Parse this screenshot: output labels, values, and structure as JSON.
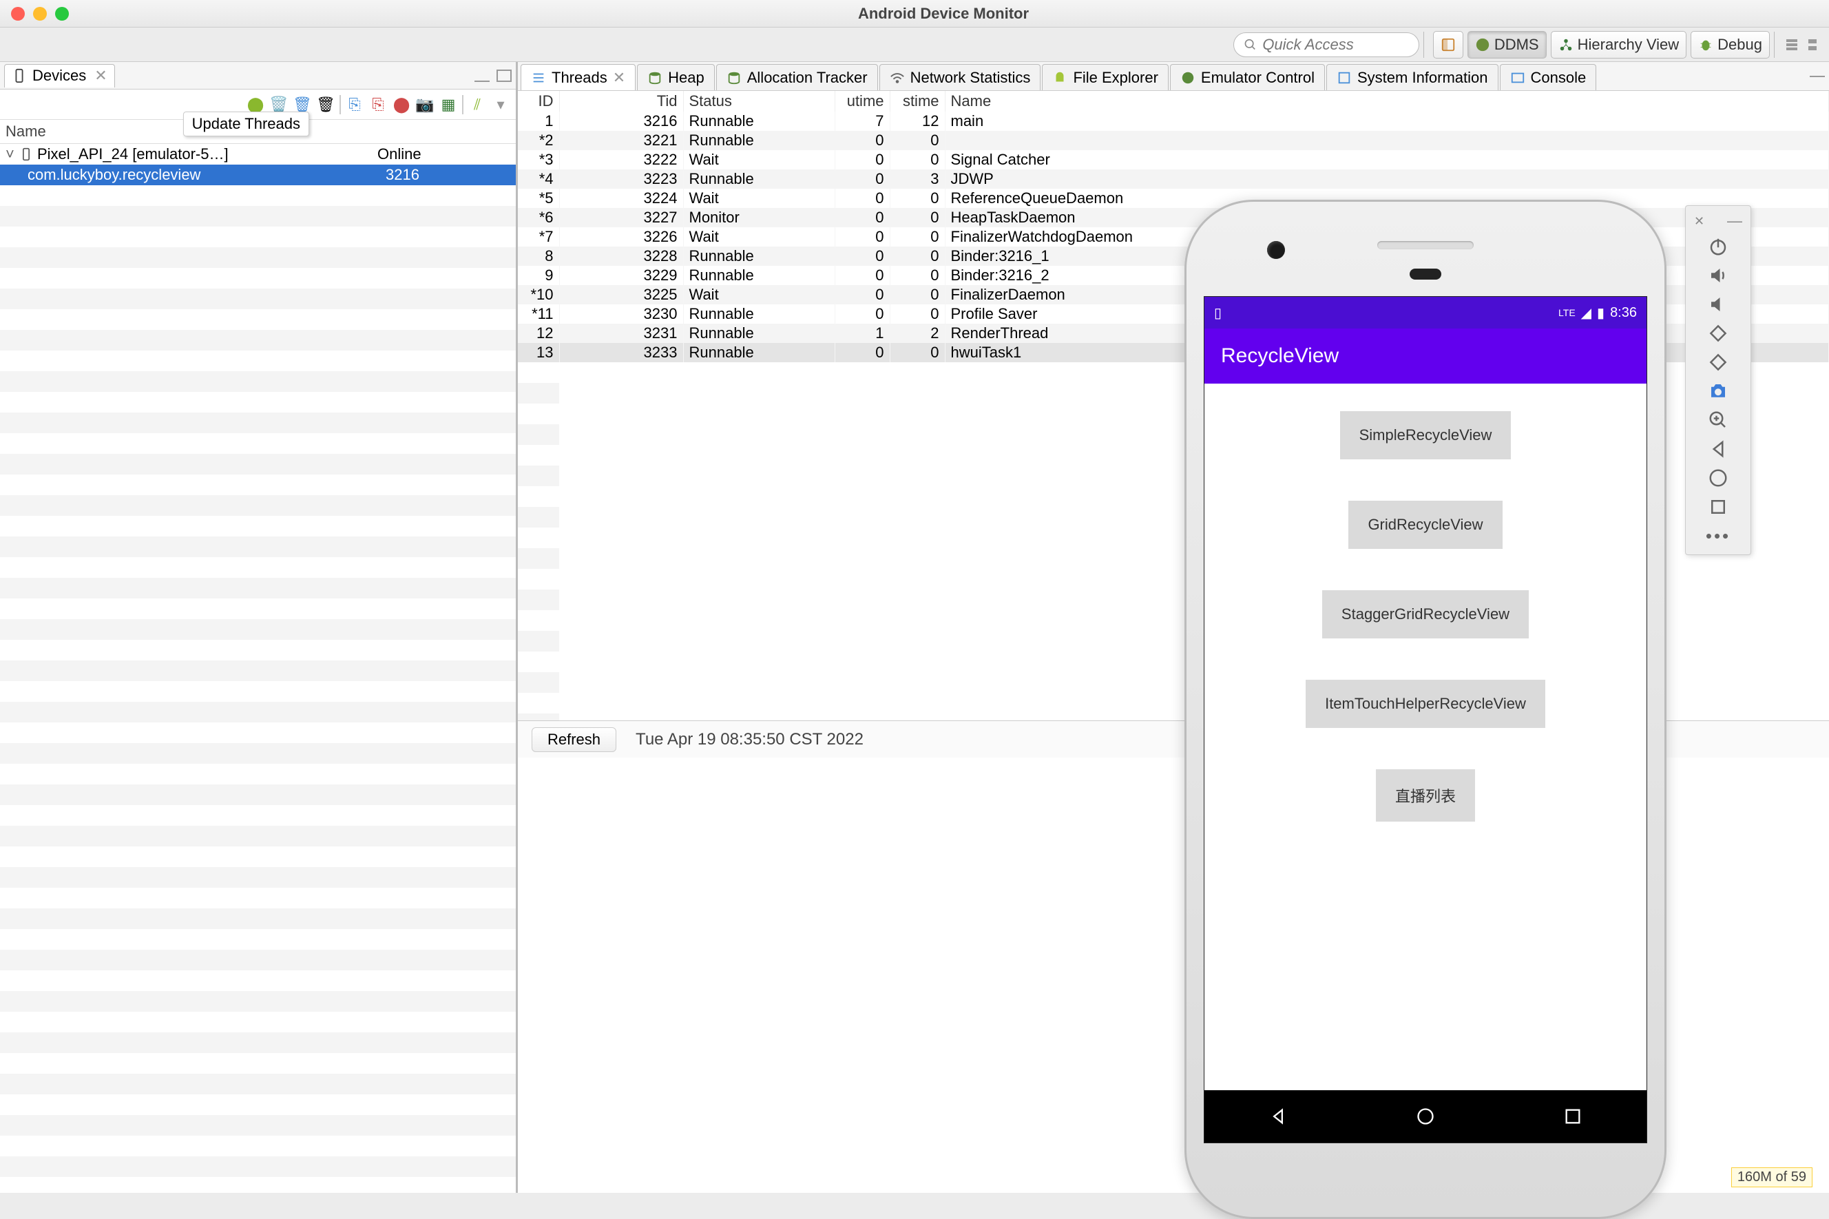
{
  "window": {
    "title": "Android Device Monitor"
  },
  "toolbar": {
    "quick_access_placeholder": "Quick Access",
    "perspectives": {
      "ddms": "DDMS",
      "hierarchy": "Hierarchy View",
      "debug": "Debug"
    }
  },
  "left_view": {
    "tab_label": "Devices",
    "tooltip": "Update Threads",
    "header": {
      "name": "Name",
      "status": ""
    },
    "device": {
      "label": "Pixel_API_24 [emulator-5…]",
      "status": "Online"
    },
    "process": {
      "label": "com.luckyboy.recycleview",
      "pid": "3216"
    }
  },
  "right_view": {
    "tabs": {
      "threads": "Threads",
      "heap": "Heap",
      "allocation": "Allocation Tracker",
      "network": "Network Statistics",
      "file": "File Explorer",
      "emulator": "Emulator Control",
      "sysinfo": "System Information",
      "console": "Console"
    },
    "active_tab": "threads"
  },
  "threads": {
    "columns": {
      "id": "ID",
      "tid": "Tid",
      "status": "Status",
      "utime": "utime",
      "stime": "stime",
      "name": "Name"
    },
    "rows": [
      {
        "id": "1",
        "tid": "3216",
        "status": "Runnable",
        "utime": "7",
        "stime": "12",
        "name": "main"
      },
      {
        "id": "*2",
        "tid": "3221",
        "status": "Runnable",
        "utime": "0",
        "stime": "0",
        "name": ""
      },
      {
        "id": "*3",
        "tid": "3222",
        "status": "Wait",
        "utime": "0",
        "stime": "0",
        "name": "Signal Catcher"
      },
      {
        "id": "*4",
        "tid": "3223",
        "status": "Runnable",
        "utime": "0",
        "stime": "3",
        "name": "JDWP"
      },
      {
        "id": "*5",
        "tid": "3224",
        "status": "Wait",
        "utime": "0",
        "stime": "0",
        "name": "ReferenceQueueDaemon"
      },
      {
        "id": "*6",
        "tid": "3227",
        "status": "Monitor",
        "utime": "0",
        "stime": "0",
        "name": "HeapTaskDaemon"
      },
      {
        "id": "*7",
        "tid": "3226",
        "status": "Wait",
        "utime": "0",
        "stime": "0",
        "name": "FinalizerWatchdogDaemon"
      },
      {
        "id": "8",
        "tid": "3228",
        "status": "Runnable",
        "utime": "0",
        "stime": "0",
        "name": "Binder:3216_1"
      },
      {
        "id": "9",
        "tid": "3229",
        "status": "Runnable",
        "utime": "0",
        "stime": "0",
        "name": "Binder:3216_2"
      },
      {
        "id": "*10",
        "tid": "3225",
        "status": "Wait",
        "utime": "0",
        "stime": "0",
        "name": "FinalizerDaemon"
      },
      {
        "id": "*11",
        "tid": "3230",
        "status": "Runnable",
        "utime": "0",
        "stime": "0",
        "name": "Profile Saver"
      },
      {
        "id": "12",
        "tid": "3231",
        "status": "Runnable",
        "utime": "1",
        "stime": "2",
        "name": "RenderThread"
      },
      {
        "id": "13",
        "tid": "3233",
        "status": "Runnable",
        "utime": "0",
        "stime": "0",
        "name": "hwuiTask1"
      }
    ],
    "refresh_label": "Refresh",
    "timestamp": "Tue Apr 19 08:35:50 CST 2022"
  },
  "emulator": {
    "status_time": "8:36",
    "app_title": "RecycleView",
    "buttons": [
      "SimpleRecycleView",
      "GridRecycleView",
      "StaggerGridRecycleView",
      "ItemTouchHelperRecycleView",
      "直播列表"
    ]
  },
  "footer": {
    "mem": "160M of 59"
  }
}
